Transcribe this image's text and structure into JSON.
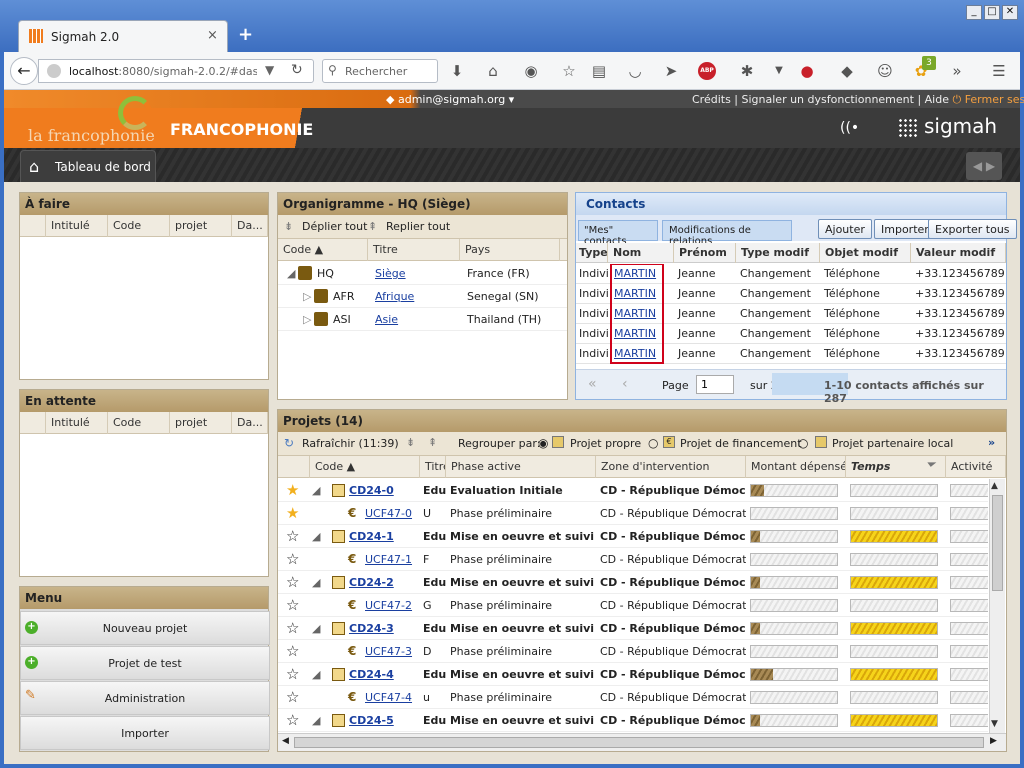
{
  "browser": {
    "tab_title": "Sigmah 2.0",
    "tab_close": "×",
    "new_tab": "+",
    "url_host": "localhost",
    "url_rest": ":8080/sigmah-2.0.2/#dashbo",
    "search_placeholder": "Rechercher",
    "badge_count": "3",
    "abp": "ABP"
  },
  "header": {
    "org_logo_text": "la francophonie",
    "org_name": "FRANCOPHONIE",
    "user": "admin@sigmah.org",
    "links": "Crédits | Signaler un dysfonctionnement | Aide",
    "logout": "Fermer session",
    "brand": "sigmah"
  },
  "tabs": {
    "dashboard": "Tableau de bord"
  },
  "todo": {
    "title": "À faire",
    "columns": [
      "Intitulé",
      "Code",
      "projet",
      "Da..."
    ]
  },
  "waiting": {
    "title": "En attente",
    "columns": [
      "Intitulé",
      "Code",
      "projet",
      "Da..."
    ]
  },
  "menu": {
    "title": "Menu",
    "items": [
      "Nouveau projet",
      "Projet de test",
      "Administration",
      "Importer"
    ]
  },
  "orgchart": {
    "title": "Organigramme - HQ (Siège)",
    "expand_all": "Déplier tout",
    "collapse_all": "Replier tout",
    "columns": [
      "Code",
      "Titre",
      "Pays"
    ],
    "rows": [
      {
        "code": "HQ",
        "title": "Siège",
        "country": "France (FR)"
      },
      {
        "code": "AFR",
        "title": "Afrique",
        "country": "Senegal (SN)"
      },
      {
        "code": "ASI",
        "title": "Asie",
        "country": "Thailand (TH)"
      }
    ]
  },
  "contacts": {
    "title": "Contacts",
    "tab_mine": "\"Mes\" contacts",
    "tab_changes": "Modifications de relations",
    "btn_add": "Ajouter",
    "btn_import": "Importer",
    "btn_export": "Exporter tous",
    "columns": [
      "Type",
      "Nom",
      "Prénom",
      "Type modif",
      "Objet modif",
      "Valeur modif"
    ],
    "rows": [
      {
        "type": "Indivi",
        "name": "MARTIN",
        "first": "Jeanne",
        "mod_type": "Changement",
        "mod_obj": "Téléphone",
        "mod_val": "+33.123456789"
      },
      {
        "type": "Indivi",
        "name": "MARTIN",
        "first": "Jeanne",
        "mod_type": "Changement",
        "mod_obj": "Téléphone",
        "mod_val": "+33.123456789"
      },
      {
        "type": "Indivi",
        "name": "MARTIN",
        "first": "Jeanne",
        "mod_type": "Changement",
        "mod_obj": "Téléphone",
        "mod_val": "+33.123456789"
      },
      {
        "type": "Indivi",
        "name": "MARTIN",
        "first": "Jeanne",
        "mod_type": "Changement",
        "mod_obj": "Téléphone",
        "mod_val": "+33.123456789"
      },
      {
        "type": "Indivi",
        "name": "MARTIN",
        "first": "Jeanne",
        "mod_type": "Changement",
        "mod_obj": "Téléphone",
        "mod_val": "+33.123456789"
      }
    ],
    "page_label": "Page",
    "page_value": "1",
    "page_of": "sur 2",
    "status": "1-10 contacts affichés sur 287"
  },
  "projects": {
    "title": "Projets (14)",
    "refresh": "Rafraîchir",
    "refresh_time": "(11:39)",
    "group_by": "Regrouper par:",
    "opt_own": "Projet propre",
    "opt_funding": "Projet de financement",
    "opt_partner": "Projet partenaire local",
    "more": "»",
    "columns": [
      "Code",
      "Titre",
      "Phase active",
      "Zone d'intervention",
      "Montant dépensé",
      "Temps",
      "Activité"
    ],
    "rows": [
      {
        "star": "★",
        "starred": true,
        "code": "CD24-0",
        "title": "Edu",
        "phase": "Evaluation Initiale",
        "zone": "CD - République Démocrat",
        "parent": true,
        "spent": 0.15,
        "time": 0
      },
      {
        "star": "★",
        "starred": true,
        "code": "UCF47-0",
        "title": "U",
        "phase": "Phase préliminaire",
        "zone": "CD - République Démocratique",
        "parent": false,
        "spent": 0,
        "time": 0
      },
      {
        "star": "☆",
        "starred": false,
        "code": "CD24-1",
        "title": "Edu",
        "phase": "Mise en oeuvre et suivi du",
        "zone": "CD - République Démocrat",
        "parent": true,
        "spent": 0.1,
        "time": 1
      },
      {
        "star": "☆",
        "starred": false,
        "code": "UCF47-1",
        "title": "F",
        "phase": "Phase préliminaire",
        "zone": "CD - République Démocratique",
        "parent": false,
        "spent": 0,
        "time": 0
      },
      {
        "star": "☆",
        "starred": false,
        "code": "CD24-2",
        "title": "Edu",
        "phase": "Mise en oeuvre et suivi du",
        "zone": "CD - République Démocrat",
        "parent": true,
        "spent": 0.1,
        "time": 1
      },
      {
        "star": "☆",
        "starred": false,
        "code": "UCF47-2",
        "title": "G",
        "phase": "Phase préliminaire",
        "zone": "CD - République Démocratique",
        "parent": false,
        "spent": 0,
        "time": 0
      },
      {
        "star": "☆",
        "starred": false,
        "code": "CD24-3",
        "title": "Edu",
        "phase": "Mise en oeuvre et suivi du",
        "zone": "CD - République Démocrat",
        "parent": true,
        "spent": 0.1,
        "time": 1
      },
      {
        "star": "☆",
        "starred": false,
        "code": "UCF47-3",
        "title": "D",
        "phase": "Phase préliminaire",
        "zone": "CD - République Démocratique",
        "parent": false,
        "spent": 0,
        "time": 0
      },
      {
        "star": "☆",
        "starred": false,
        "code": "CD24-4",
        "title": "Edu",
        "phase": "Mise en oeuvre et suivi du",
        "zone": "CD - République Démocrat",
        "parent": true,
        "spent": 0.25,
        "time": 1
      },
      {
        "star": "☆",
        "starred": false,
        "code": "UCF47-4",
        "title": "u",
        "phase": "Phase préliminaire",
        "zone": "CD - République Démocratique",
        "parent": false,
        "spent": 0,
        "time": 0
      },
      {
        "star": "☆",
        "starred": false,
        "code": "CD24-5",
        "title": "Edu",
        "phase": "Mise en oeuvre et suivi du",
        "zone": "CD - République Démocrat",
        "parent": true,
        "spent": 0.1,
        "time": 1
      }
    ]
  },
  "colors": {
    "accent": "#f07c1e",
    "panel_header": "#b59a6a",
    "highlight": "#d0021b"
  }
}
